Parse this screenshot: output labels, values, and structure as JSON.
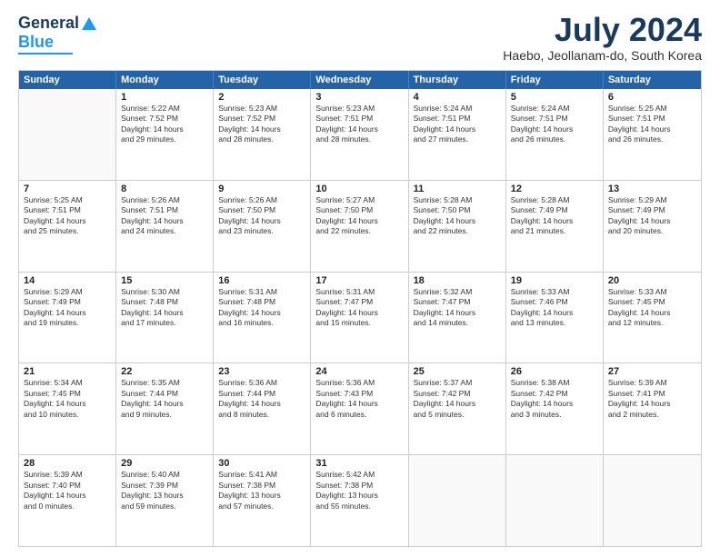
{
  "logo": {
    "line1": "General",
    "line2": "Blue"
  },
  "header": {
    "month": "July 2024",
    "location": "Haebo, Jeollanam-do, South Korea"
  },
  "weekdays": [
    "Sunday",
    "Monday",
    "Tuesday",
    "Wednesday",
    "Thursday",
    "Friday",
    "Saturday"
  ],
  "rows": [
    [
      {
        "day": "",
        "info": ""
      },
      {
        "day": "1",
        "info": "Sunrise: 5:22 AM\nSunset: 7:52 PM\nDaylight: 14 hours\nand 29 minutes."
      },
      {
        "day": "2",
        "info": "Sunrise: 5:23 AM\nSunset: 7:52 PM\nDaylight: 14 hours\nand 28 minutes."
      },
      {
        "day": "3",
        "info": "Sunrise: 5:23 AM\nSunset: 7:51 PM\nDaylight: 14 hours\nand 28 minutes."
      },
      {
        "day": "4",
        "info": "Sunrise: 5:24 AM\nSunset: 7:51 PM\nDaylight: 14 hours\nand 27 minutes."
      },
      {
        "day": "5",
        "info": "Sunrise: 5:24 AM\nSunset: 7:51 PM\nDaylight: 14 hours\nand 26 minutes."
      },
      {
        "day": "6",
        "info": "Sunrise: 5:25 AM\nSunset: 7:51 PM\nDaylight: 14 hours\nand 26 minutes."
      }
    ],
    [
      {
        "day": "7",
        "info": "Sunrise: 5:25 AM\nSunset: 7:51 PM\nDaylight: 14 hours\nand 25 minutes."
      },
      {
        "day": "8",
        "info": "Sunrise: 5:26 AM\nSunset: 7:51 PM\nDaylight: 14 hours\nand 24 minutes."
      },
      {
        "day": "9",
        "info": "Sunrise: 5:26 AM\nSunset: 7:50 PM\nDaylight: 14 hours\nand 23 minutes."
      },
      {
        "day": "10",
        "info": "Sunrise: 5:27 AM\nSunset: 7:50 PM\nDaylight: 14 hours\nand 22 minutes."
      },
      {
        "day": "11",
        "info": "Sunrise: 5:28 AM\nSunset: 7:50 PM\nDaylight: 14 hours\nand 22 minutes."
      },
      {
        "day": "12",
        "info": "Sunrise: 5:28 AM\nSunset: 7:49 PM\nDaylight: 14 hours\nand 21 minutes."
      },
      {
        "day": "13",
        "info": "Sunrise: 5:29 AM\nSunset: 7:49 PM\nDaylight: 14 hours\nand 20 minutes."
      }
    ],
    [
      {
        "day": "14",
        "info": "Sunrise: 5:29 AM\nSunset: 7:49 PM\nDaylight: 14 hours\nand 19 minutes."
      },
      {
        "day": "15",
        "info": "Sunrise: 5:30 AM\nSunset: 7:48 PM\nDaylight: 14 hours\nand 17 minutes."
      },
      {
        "day": "16",
        "info": "Sunrise: 5:31 AM\nSunset: 7:48 PM\nDaylight: 14 hours\nand 16 minutes."
      },
      {
        "day": "17",
        "info": "Sunrise: 5:31 AM\nSunset: 7:47 PM\nDaylight: 14 hours\nand 15 minutes."
      },
      {
        "day": "18",
        "info": "Sunrise: 5:32 AM\nSunset: 7:47 PM\nDaylight: 14 hours\nand 14 minutes."
      },
      {
        "day": "19",
        "info": "Sunrise: 5:33 AM\nSunset: 7:46 PM\nDaylight: 14 hours\nand 13 minutes."
      },
      {
        "day": "20",
        "info": "Sunrise: 5:33 AM\nSunset: 7:45 PM\nDaylight: 14 hours\nand 12 minutes."
      }
    ],
    [
      {
        "day": "21",
        "info": "Sunrise: 5:34 AM\nSunset: 7:45 PM\nDaylight: 14 hours\nand 10 minutes."
      },
      {
        "day": "22",
        "info": "Sunrise: 5:35 AM\nSunset: 7:44 PM\nDaylight: 14 hours\nand 9 minutes."
      },
      {
        "day": "23",
        "info": "Sunrise: 5:36 AM\nSunset: 7:44 PM\nDaylight: 14 hours\nand 8 minutes."
      },
      {
        "day": "24",
        "info": "Sunrise: 5:36 AM\nSunset: 7:43 PM\nDaylight: 14 hours\nand 6 minutes."
      },
      {
        "day": "25",
        "info": "Sunrise: 5:37 AM\nSunset: 7:42 PM\nDaylight: 14 hours\nand 5 minutes."
      },
      {
        "day": "26",
        "info": "Sunrise: 5:38 AM\nSunset: 7:42 PM\nDaylight: 14 hours\nand 3 minutes."
      },
      {
        "day": "27",
        "info": "Sunrise: 5:39 AM\nSunset: 7:41 PM\nDaylight: 14 hours\nand 2 minutes."
      }
    ],
    [
      {
        "day": "28",
        "info": "Sunrise: 5:39 AM\nSunset: 7:40 PM\nDaylight: 14 hours\nand 0 minutes."
      },
      {
        "day": "29",
        "info": "Sunrise: 5:40 AM\nSunset: 7:39 PM\nDaylight: 13 hours\nand 59 minutes."
      },
      {
        "day": "30",
        "info": "Sunrise: 5:41 AM\nSunset: 7:38 PM\nDaylight: 13 hours\nand 57 minutes."
      },
      {
        "day": "31",
        "info": "Sunrise: 5:42 AM\nSunset: 7:38 PM\nDaylight: 13 hours\nand 55 minutes."
      },
      {
        "day": "",
        "info": ""
      },
      {
        "day": "",
        "info": ""
      },
      {
        "day": "",
        "info": ""
      }
    ]
  ]
}
